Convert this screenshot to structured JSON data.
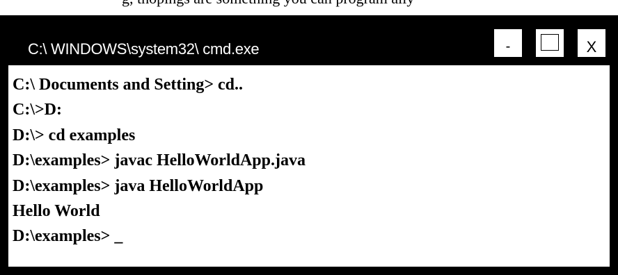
{
  "top_text": "g, thopings are something you can program ally",
  "window": {
    "title": "C:\\ WINDOWS\\system32\\ cmd.exe",
    "buttons": {
      "minimize": "-",
      "maximize": "",
      "close": "X"
    }
  },
  "console": {
    "lines": [
      "C:\\ Documents and Setting> cd..",
      "C:\\>D:",
      "D:\\> cd examples",
      "D:\\examples> javac HelloWorldApp.java",
      "D:\\examples> java HelloWorldApp",
      "Hello World",
      "D:\\examples> _"
    ]
  }
}
